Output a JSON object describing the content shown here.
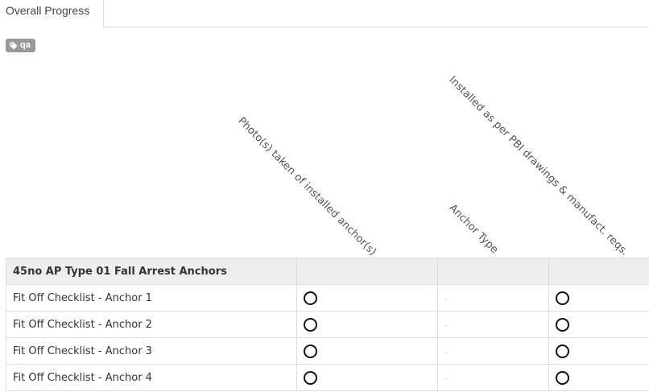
{
  "tabs": [
    {
      "label": "Overall Progress"
    }
  ],
  "tag": {
    "label": "qa",
    "icon": "tag-icon"
  },
  "columns": [
    {
      "label": "Photo(s) taken of installed anchor(s)"
    },
    {
      "label": "Anchor Type"
    },
    {
      "label": "Installed as per PBI drawings & manufact. reqs."
    }
  ],
  "group": {
    "label": "45no AP Type 01 Fall Arrest Anchors"
  },
  "rows": [
    {
      "label": "Fit Off Checklist - Anchor 1",
      "anchor_type": "-"
    },
    {
      "label": "Fit Off Checklist - Anchor 2",
      "anchor_type": "-"
    },
    {
      "label": "Fit Off Checklist - Anchor 3",
      "anchor_type": "-"
    },
    {
      "label": "Fit Off Checklist - Anchor 4",
      "anchor_type": "-"
    }
  ]
}
